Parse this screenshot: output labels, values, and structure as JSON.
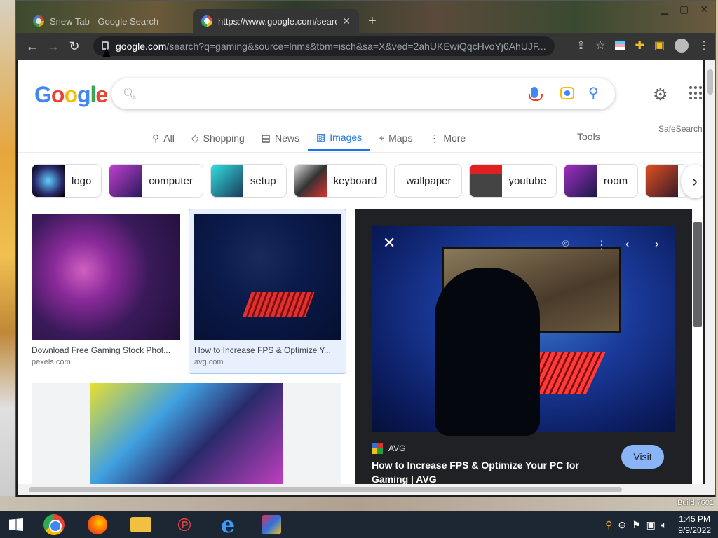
{
  "browser": {
    "tabs": [
      {
        "title": "Snew Tab - Google Search"
      },
      {
        "title": "https://www.google.com/search?"
      }
    ],
    "url_host": "google.com",
    "url_path": "/search?q=gaming&source=lnms&tbm=isch&sa=X&ved=2ahUKEwiQqcHvoYj6AhUJF...",
    "window_controls": [
      "minimize",
      "maximize",
      "close"
    ]
  },
  "google": {
    "logo": [
      "G",
      "o",
      "o",
      "g",
      "l",
      "e"
    ],
    "search_value": "",
    "nav_tabs": [
      {
        "label": "All",
        "icon": "search-icon"
      },
      {
        "label": "Shopping",
        "icon": "tag-icon"
      },
      {
        "label": "News",
        "icon": "news-icon"
      },
      {
        "label": "Images",
        "icon": "image-icon",
        "active": true
      },
      {
        "label": "Maps",
        "icon": "map-pin-icon"
      },
      {
        "label": "More",
        "icon": "more-icon"
      }
    ],
    "tools": "Tools",
    "safesearch": "SafeSearch",
    "chips": [
      "logo",
      "computer",
      "setup",
      "keyboard",
      "wallpaper",
      "youtube",
      "room"
    ],
    "results": [
      {
        "caption": "Download Free Gaming Stock Phot...",
        "source": "pexels.com"
      },
      {
        "caption": "How to Increase FPS & Optimize Y...",
        "source": "avg.com"
      }
    ],
    "preview": {
      "source": "AVG",
      "title": "How to Increase FPS & Optimize Your PC for Gaming | AVG",
      "visit": "Visit"
    }
  },
  "desktop": {
    "build": "Build 7601"
  },
  "taskbar": {
    "time": "1:45 PM",
    "date": "9/9/2022"
  },
  "colors": {
    "accent": "#1a73e8",
    "visit_button": "#8ab4f8",
    "taskbar": "#1c2733"
  }
}
